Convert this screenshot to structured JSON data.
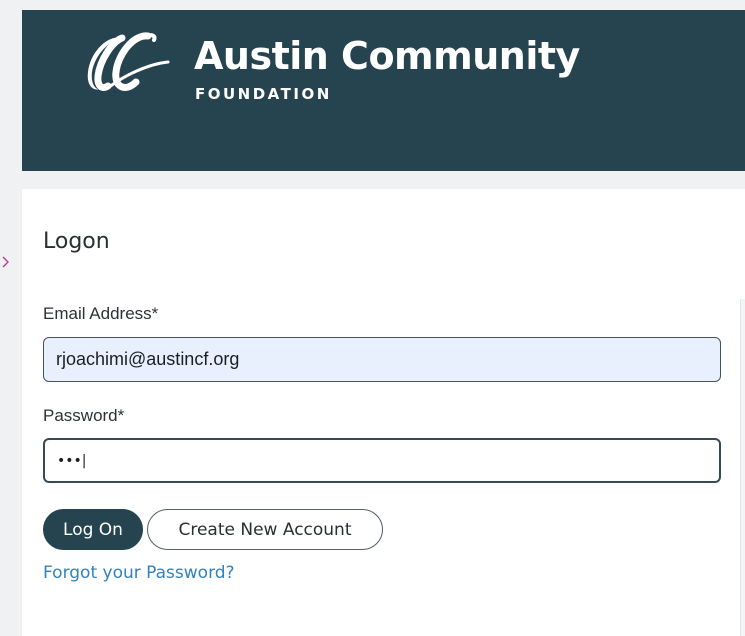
{
  "header": {
    "brand_title": "Austin Community",
    "brand_subtitle": "FOUNDATION",
    "logo_icon": "acf-script-logo-icon",
    "background_color": "#25444f"
  },
  "form": {
    "heading": "Logon",
    "email": {
      "label": "Email Address*",
      "value": "rjoachimi@austincf.org",
      "autofill_color": "#e8f0fe"
    },
    "password": {
      "label": "Password*",
      "value": "•••|"
    },
    "buttons": {
      "log_on_label": "Log On",
      "create_account_label": "Create New Account"
    },
    "forgot_link": "Forgot your Password?",
    "link_color": "#2f83bf"
  }
}
